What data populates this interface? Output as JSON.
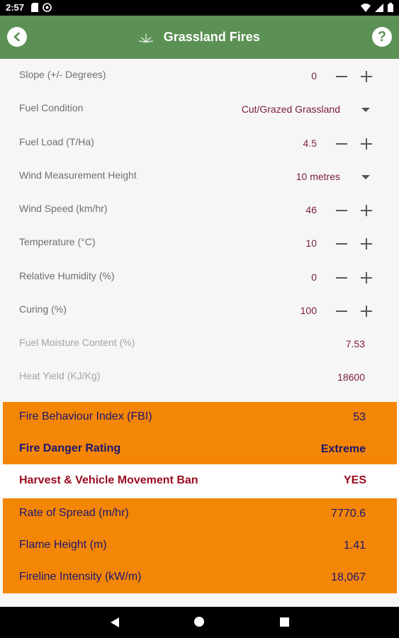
{
  "status_bar": {
    "time": "2:57",
    "left_icons": [
      "sd-card-icon",
      "notification-icon"
    ],
    "right_icons": [
      "wifi-icon",
      "signal-icon",
      "battery-icon"
    ]
  },
  "app_bar": {
    "title": "Grassland Fires",
    "help_label": "?",
    "colors": {
      "background": "#5b9154",
      "text": "#ffffff"
    }
  },
  "inputs": [
    {
      "label": "Slope (+/- Degrees)",
      "value": "0",
      "control": "stepper"
    },
    {
      "label": "Fuel Condition",
      "value": "Cut/Grazed Grassland",
      "control": "dropdown"
    },
    {
      "label": "Fuel Load (T/Ha)",
      "value": "4.5",
      "control": "stepper"
    },
    {
      "label": "Wind Measurement Height",
      "value": "10 metres",
      "control": "dropdown"
    },
    {
      "label": "Wind Speed (km/hr)",
      "value": "46",
      "control": "stepper"
    },
    {
      "label": "Temperature (°C)",
      "value": "10",
      "control": "stepper"
    },
    {
      "label": "Relative Humidity (%)",
      "value": "0",
      "control": "stepper"
    },
    {
      "label": "Curing (%)",
      "value": "100",
      "control": "stepper"
    },
    {
      "label": "Fuel Moisture Content (%)",
      "value": "7.53",
      "control": "readonly"
    },
    {
      "label": "Heat Yield (KJ/Kg)",
      "value": "18600",
      "control": "readonly"
    }
  ],
  "rating_block": {
    "fbi_label": "Fire Behaviour Index (FBI)",
    "fbi_value": "53",
    "rating_label": "Fire Danger Rating",
    "rating_value": "Extreme"
  },
  "ban": {
    "label": "Harvest & Vehicle Movement Ban",
    "value": "YES"
  },
  "behaviour_block": {
    "rows": [
      {
        "label": "Rate of Spread (m/hr)",
        "value": "7770.6"
      },
      {
        "label": "Flame Height (m)",
        "value": "1.41"
      },
      {
        "label": "Fireline Intensity (kW/m)",
        "value": "18,067"
      }
    ]
  },
  "colors": {
    "accent_orange": "#f48606",
    "value_text": "#7a1f36",
    "result_text": "#1d1670",
    "ban_text": "#9c0b1e"
  }
}
